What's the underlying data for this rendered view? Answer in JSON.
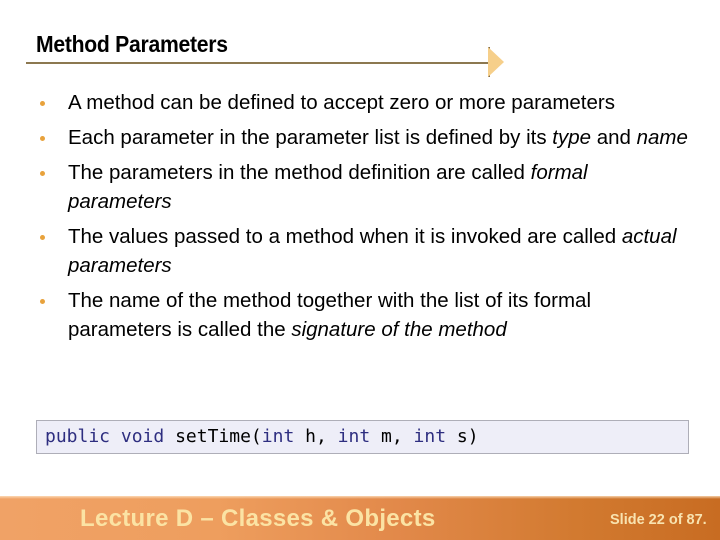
{
  "slide": {
    "title": "Method Parameters",
    "bullets": [
      {
        "parts": [
          {
            "text": "A method can be defined to accept zero or more parameters",
            "italic": false
          }
        ]
      },
      {
        "parts": [
          {
            "text": "Each parameter in the parameter list is defined by its ",
            "italic": false
          },
          {
            "text": "type",
            "italic": true
          },
          {
            "text": " and ",
            "italic": false
          },
          {
            "text": "name",
            "italic": true
          }
        ]
      },
      {
        "parts": [
          {
            "text": "The parameters in the method definition are called ",
            "italic": false
          },
          {
            "text": "formal parameters",
            "italic": true
          }
        ]
      },
      {
        "parts": [
          {
            "text": "The values passed to a method when it is invoked are called ",
            "italic": false
          },
          {
            "text": "actual parameters",
            "italic": true
          }
        ]
      },
      {
        "parts": [
          {
            "text": "The name of the method together with the list of its formal parameters is called the ",
            "italic": false
          },
          {
            "text": "signature of the method",
            "italic": true
          }
        ]
      }
    ],
    "code": {
      "tokens": [
        {
          "text": "public",
          "kind": "keyword"
        },
        {
          "text": " ",
          "kind": "plain"
        },
        {
          "text": "void",
          "kind": "keyword"
        },
        {
          "text": " setTime(",
          "kind": "plain"
        },
        {
          "text": "int",
          "kind": "keyword"
        },
        {
          "text": " h, ",
          "kind": "plain"
        },
        {
          "text": "int",
          "kind": "keyword"
        },
        {
          "text": " m, ",
          "kind": "plain"
        },
        {
          "text": "int",
          "kind": "keyword"
        },
        {
          "text": " s)",
          "kind": "plain"
        }
      ]
    }
  },
  "footer": {
    "lecture_title": "Lecture D – Classes & Objects",
    "slide_counter": "Slide 22 of 87."
  },
  "colors": {
    "bullet": "#e8a23c",
    "title_rule": "#8c7850",
    "arrow_fill": "#f6cf8a",
    "code_background": "#eeeef8",
    "code_keyword": "#2e2e80",
    "footer_text": "#fbe3a4",
    "footer_start": "#f0a266",
    "footer_end": "#c86c22"
  }
}
